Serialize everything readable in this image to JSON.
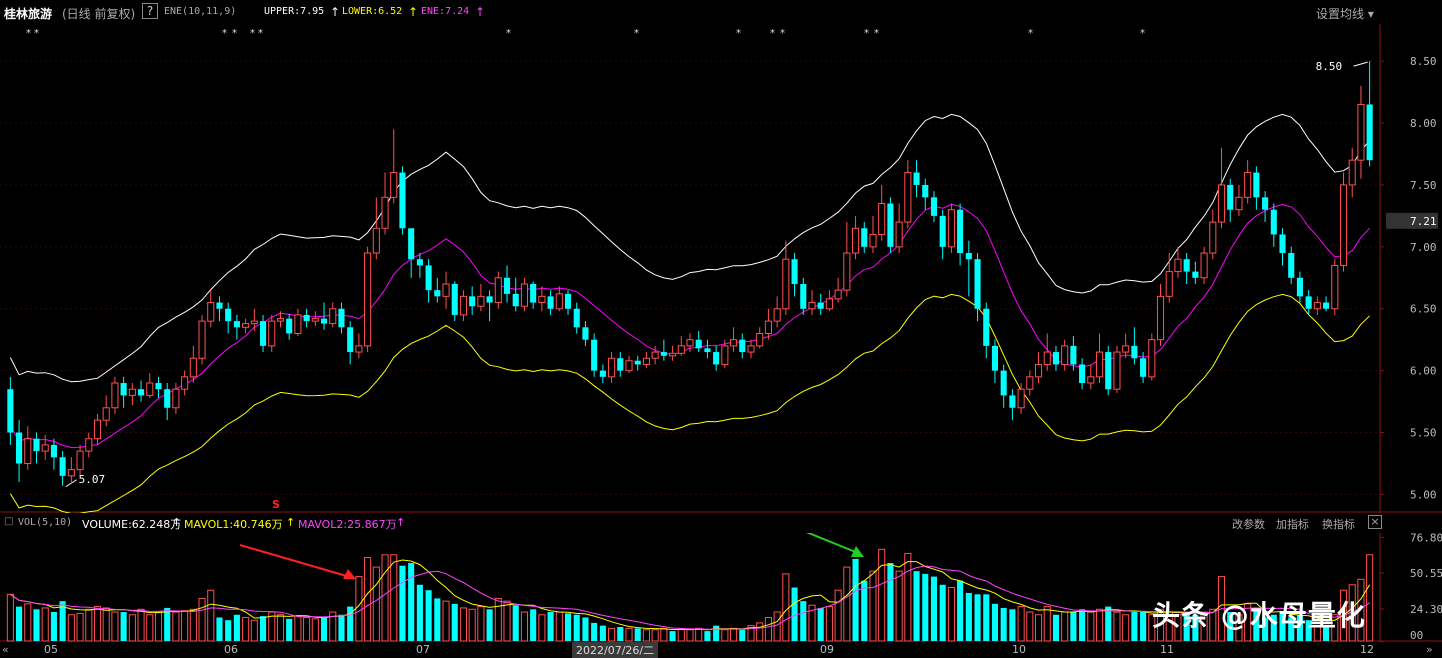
{
  "header": {
    "stock_name": "桂林旅游",
    "period_label": "(日线 前复权)",
    "help_icon": "?",
    "indicator_name": "ENE(10,11,9)",
    "upper_label": "UPPER:7.95",
    "lower_label": "LOWER:6.52",
    "ene_label": "ENE:7.24",
    "settings_label": "设置均线"
  },
  "vol_header": {
    "indicator_name": "VOL(5,10)",
    "volume_label": "VOLUME:62.248万",
    "mavol1_label": "MAVOL1:40.746万",
    "mavol2_label": "MAVOL2:25.867万",
    "btn_params": "改参数",
    "btn_add": "加指标",
    "btn_switch": "换指标",
    "close": "×"
  },
  "price_axis": {
    "ticks": [
      "8.50",
      "8.00",
      "7.50",
      "7.00",
      "6.50",
      "6.00",
      "5.50",
      "5.00"
    ],
    "current_price": "7.21"
  },
  "vol_axis": {
    "ticks": [
      "76.80",
      "50.55",
      "24.30",
      "00"
    ]
  },
  "x_axis": {
    "months": [
      "05",
      "06",
      "07",
      "09",
      "10",
      "11",
      "12"
    ],
    "cursor_date": "2022/07/26/二"
  },
  "annotations": {
    "high_label": "8.50",
    "low_label": "5.07",
    "signal_mark": "S"
  },
  "watermark": "头条 @水母量化",
  "colors": {
    "up": "#ff5050",
    "down": "#00ffff",
    "upper": "#ffffff",
    "ene": "#ff00ff",
    "lower": "#ffff00",
    "axis": "#8b1010"
  },
  "chart_data": {
    "type": "candlestick",
    "ylim": [
      4.85,
      8.8
    ],
    "vol_ylim": [
      0,
      80
    ],
    "candles": [
      [
        5.85,
        5.5,
        5.95,
        5.4
      ],
      [
        5.5,
        5.25,
        5.6,
        5.1
      ],
      [
        5.25,
        5.45,
        5.55,
        5.2
      ],
      [
        5.45,
        5.35,
        5.5,
        5.25
      ],
      [
        5.35,
        5.4,
        5.48,
        5.28
      ],
      [
        5.4,
        5.3,
        5.45,
        5.2
      ],
      [
        5.3,
        5.15,
        5.35,
        5.07
      ],
      [
        5.15,
        5.2,
        5.3,
        5.1
      ],
      [
        5.2,
        5.35,
        5.4,
        5.15
      ],
      [
        5.35,
        5.45,
        5.5,
        5.3
      ],
      [
        5.45,
        5.6,
        5.65,
        5.4
      ],
      [
        5.6,
        5.7,
        5.8,
        5.55
      ],
      [
        5.7,
        5.9,
        5.95,
        5.65
      ],
      [
        5.9,
        5.8,
        5.95,
        5.7
      ],
      [
        5.8,
        5.85,
        5.9,
        5.72
      ],
      [
        5.85,
        5.8,
        5.92,
        5.75
      ],
      [
        5.8,
        5.9,
        5.98,
        5.78
      ],
      [
        5.9,
        5.85,
        5.95,
        5.78
      ],
      [
        5.85,
        5.7,
        5.9,
        5.6
      ],
      [
        5.7,
        5.85,
        5.9,
        5.65
      ],
      [
        5.85,
        5.95,
        6.0,
        5.8
      ],
      [
        5.95,
        6.1,
        6.2,
        5.9
      ],
      [
        6.1,
        6.4,
        6.45,
        6.05
      ],
      [
        6.4,
        6.55,
        6.65,
        6.35
      ],
      [
        6.55,
        6.5,
        6.6,
        6.4
      ],
      [
        6.5,
        6.4,
        6.55,
        6.3
      ],
      [
        6.4,
        6.35,
        6.45,
        6.25
      ],
      [
        6.35,
        6.38,
        6.42,
        6.3
      ],
      [
        6.38,
        6.4,
        6.5,
        6.32
      ],
      [
        6.4,
        6.2,
        6.45,
        6.15
      ],
      [
        6.2,
        6.4,
        6.45,
        6.15
      ],
      [
        6.4,
        6.42,
        6.48,
        6.35
      ],
      [
        6.42,
        6.3,
        6.46,
        6.25
      ],
      [
        6.3,
        6.45,
        6.5,
        6.28
      ],
      [
        6.45,
        6.4,
        6.5,
        6.35
      ],
      [
        6.4,
        6.42,
        6.48,
        6.36
      ],
      [
        6.42,
        6.38,
        6.55,
        6.33
      ],
      [
        6.38,
        6.5,
        6.55,
        6.35
      ],
      [
        6.5,
        6.35,
        6.55,
        6.3
      ],
      [
        6.35,
        6.15,
        6.4,
        6.05
      ],
      [
        6.15,
        6.2,
        6.3,
        6.1
      ],
      [
        6.2,
        6.95,
        7.0,
        6.15
      ],
      [
        6.95,
        7.15,
        7.4,
        6.9
      ],
      [
        7.15,
        7.4,
        7.6,
        7.1
      ],
      [
        7.4,
        7.6,
        7.95,
        7.35
      ],
      [
        7.6,
        7.15,
        7.65,
        7.1
      ],
      [
        7.15,
        6.9,
        7.0,
        6.75
      ],
      [
        6.9,
        6.85,
        6.95,
        6.75
      ],
      [
        6.85,
        6.65,
        6.9,
        6.55
      ],
      [
        6.65,
        6.6,
        6.75,
        6.55
      ],
      [
        6.6,
        6.7,
        6.8,
        6.5
      ],
      [
        6.7,
        6.45,
        6.72,
        6.4
      ],
      [
        6.45,
        6.6,
        6.65,
        6.4
      ],
      [
        6.6,
        6.52,
        6.68,
        6.45
      ],
      [
        6.52,
        6.6,
        6.7,
        6.48
      ],
      [
        6.6,
        6.55,
        6.65,
        6.4
      ],
      [
        6.55,
        6.75,
        6.8,
        6.5
      ],
      [
        6.75,
        6.62,
        6.85,
        6.55
      ],
      [
        6.62,
        6.52,
        6.75,
        6.48
      ],
      [
        6.52,
        6.7,
        6.75,
        6.48
      ],
      [
        6.7,
        6.55,
        6.72,
        6.5
      ],
      [
        6.55,
        6.6,
        6.68,
        6.48
      ],
      [
        6.6,
        6.5,
        6.65,
        6.45
      ],
      [
        6.5,
        6.62,
        6.68,
        6.48
      ],
      [
        6.62,
        6.5,
        6.65,
        6.45
      ],
      [
        6.5,
        6.35,
        6.55,
        6.3
      ],
      [
        6.35,
        6.25,
        6.4,
        6.2
      ],
      [
        6.25,
        6.0,
        6.3,
        5.95
      ],
      [
        6.0,
        5.95,
        6.05,
        5.9
      ],
      [
        5.95,
        6.1,
        6.15,
        5.9
      ],
      [
        6.1,
        6.0,
        6.15,
        5.95
      ],
      [
        6.0,
        6.08,
        6.12,
        5.98
      ],
      [
        6.08,
        6.05,
        6.12,
        6.0
      ],
      [
        6.05,
        6.1,
        6.15,
        6.02
      ],
      [
        6.1,
        6.15,
        6.2,
        6.05
      ],
      [
        6.15,
        6.12,
        6.25,
        6.08
      ],
      [
        6.12,
        6.14,
        6.2,
        6.08
      ],
      [
        6.14,
        6.2,
        6.28,
        6.12
      ],
      [
        6.2,
        6.25,
        6.3,
        6.15
      ],
      [
        6.25,
        6.18,
        6.32,
        6.15
      ],
      [
        6.18,
        6.15,
        6.25,
        6.1
      ],
      [
        6.15,
        6.05,
        6.2,
        6.0
      ],
      [
        6.05,
        6.2,
        6.25,
        6.02
      ],
      [
        6.2,
        6.25,
        6.35,
        6.15
      ],
      [
        6.25,
        6.15,
        6.3,
        6.1
      ],
      [
        6.15,
        6.2,
        6.25,
        6.1
      ],
      [
        6.2,
        6.3,
        6.35,
        6.18
      ],
      [
        6.3,
        6.4,
        6.5,
        6.25
      ],
      [
        6.4,
        6.5,
        6.6,
        6.35
      ],
      [
        6.5,
        6.9,
        7.05,
        6.45
      ],
      [
        6.9,
        6.7,
        6.95,
        6.6
      ],
      [
        6.7,
        6.5,
        6.75,
        6.45
      ],
      [
        6.5,
        6.55,
        6.65,
        6.45
      ],
      [
        6.55,
        6.5,
        6.62,
        6.45
      ],
      [
        6.5,
        6.58,
        6.65,
        6.48
      ],
      [
        6.58,
        6.65,
        6.75,
        6.55
      ],
      [
        6.65,
        6.95,
        7.2,
        6.6
      ],
      [
        6.95,
        7.15,
        7.25,
        6.9
      ],
      [
        7.15,
        7.0,
        7.2,
        6.95
      ],
      [
        7.0,
        7.1,
        7.25,
        6.95
      ],
      [
        7.1,
        7.35,
        7.5,
        7.05
      ],
      [
        7.35,
        7.0,
        7.4,
        6.95
      ],
      [
        7.0,
        7.2,
        7.35,
        6.95
      ],
      [
        7.2,
        7.6,
        7.7,
        7.15
      ],
      [
        7.6,
        7.5,
        7.7,
        7.4
      ],
      [
        7.5,
        7.4,
        7.55,
        7.3
      ],
      [
        7.4,
        7.25,
        7.45,
        7.2
      ],
      [
        7.25,
        7.0,
        7.3,
        6.9
      ],
      [
        7.0,
        7.3,
        7.35,
        6.95
      ],
      [
        7.3,
        6.95,
        7.35,
        6.85
      ],
      [
        6.95,
        6.9,
        7.05,
        6.6
      ],
      [
        6.9,
        6.5,
        6.95,
        6.4
      ],
      [
        6.5,
        6.2,
        6.55,
        6.1
      ],
      [
        6.2,
        6.0,
        6.25,
        5.9
      ],
      [
        6.0,
        5.8,
        6.05,
        5.7
      ],
      [
        5.8,
        5.7,
        5.85,
        5.6
      ],
      [
        5.7,
        5.85,
        5.9,
        5.65
      ],
      [
        5.85,
        5.95,
        6.0,
        5.8
      ],
      [
        5.95,
        6.05,
        6.15,
        5.9
      ],
      [
        6.05,
        6.15,
        6.3,
        6.0
      ],
      [
        6.15,
        6.05,
        6.2,
        6.0
      ],
      [
        6.05,
        6.2,
        6.25,
        6.0
      ],
      [
        6.2,
        6.05,
        6.28,
        6.0
      ],
      [
        6.05,
        5.9,
        6.1,
        5.85
      ],
      [
        5.9,
        5.95,
        6.05,
        5.85
      ],
      [
        5.95,
        6.15,
        6.3,
        5.9
      ],
      [
        6.15,
        5.85,
        6.2,
        5.8
      ],
      [
        5.85,
        6.15,
        6.2,
        5.82
      ],
      [
        6.15,
        6.2,
        6.3,
        6.1
      ],
      [
        6.2,
        6.1,
        6.35,
        6.05
      ],
      [
        6.1,
        5.95,
        6.15,
        5.9
      ],
      [
        5.95,
        6.25,
        6.3,
        5.92
      ],
      [
        6.25,
        6.6,
        6.7,
        6.2
      ],
      [
        6.6,
        6.8,
        6.95,
        6.55
      ],
      [
        6.8,
        6.9,
        7.0,
        6.75
      ],
      [
        6.9,
        6.8,
        6.95,
        6.7
      ],
      [
        6.8,
        6.75,
        6.88,
        6.7
      ],
      [
        6.75,
        6.95,
        7.0,
        6.7
      ],
      [
        6.95,
        7.2,
        7.3,
        6.9
      ],
      [
        7.2,
        7.5,
        7.8,
        7.15
      ],
      [
        7.5,
        7.3,
        7.55,
        7.2
      ],
      [
        7.3,
        7.4,
        7.5,
        7.25
      ],
      [
        7.4,
        7.6,
        7.7,
        7.35
      ],
      [
        7.6,
        7.4,
        7.65,
        7.3
      ],
      [
        7.4,
        7.3,
        7.45,
        7.2
      ],
      [
        7.3,
        7.1,
        7.35,
        7.0
      ],
      [
        7.1,
        6.95,
        7.15,
        6.85
      ],
      [
        6.95,
        6.75,
        7.0,
        6.7
      ],
      [
        6.75,
        6.6,
        6.8,
        6.55
      ],
      [
        6.6,
        6.5,
        6.65,
        6.45
      ],
      [
        6.5,
        6.55,
        6.6,
        6.45
      ],
      [
        6.55,
        6.5,
        6.6,
        6.48
      ],
      [
        6.5,
        6.85,
        6.9,
        6.45
      ],
      [
        6.85,
        7.5,
        7.6,
        6.8
      ],
      [
        7.5,
        7.7,
        7.8,
        7.4
      ],
      [
        7.7,
        8.15,
        8.3,
        7.55
      ],
      [
        8.15,
        7.7,
        8.5,
        7.65
      ]
    ],
    "volumes": [
      [
        35,
        1
      ],
      [
        26,
        0
      ],
      [
        28,
        1
      ],
      [
        24,
        0
      ],
      [
        25,
        1
      ],
      [
        22,
        0
      ],
      [
        30,
        0
      ],
      [
        20,
        1
      ],
      [
        21,
        1
      ],
      [
        24,
        1
      ],
      [
        26,
        1
      ],
      [
        25,
        1
      ],
      [
        22,
        1
      ],
      [
        22,
        0
      ],
      [
        20,
        1
      ],
      [
        24,
        1
      ],
      [
        20,
        1
      ],
      [
        22,
        1
      ],
      [
        25,
        0
      ],
      [
        22,
        1
      ],
      [
        23,
        1
      ],
      [
        24,
        1
      ],
      [
        32,
        1
      ],
      [
        38,
        1
      ],
      [
        18,
        0
      ],
      [
        16,
        0
      ],
      [
        20,
        0
      ],
      [
        18,
        1
      ],
      [
        16,
        1
      ],
      [
        19,
        0
      ],
      [
        22,
        1
      ],
      [
        20,
        1
      ],
      [
        17,
        0
      ],
      [
        19,
        1
      ],
      [
        18,
        1
      ],
      [
        17,
        1
      ],
      [
        18,
        0
      ],
      [
        22,
        1
      ],
      [
        20,
        0
      ],
      [
        26,
        0
      ],
      [
        48,
        1
      ],
      [
        62,
        1
      ],
      [
        55,
        1
      ],
      [
        64,
        1
      ],
      [
        64,
        1
      ],
      [
        56,
        0
      ],
      [
        58,
        0
      ],
      [
        42,
        0
      ],
      [
        38,
        0
      ],
      [
        32,
        0
      ],
      [
        30,
        1
      ],
      [
        28,
        0
      ],
      [
        25,
        1
      ],
      [
        24,
        1
      ],
      [
        26,
        1
      ],
      [
        24,
        0
      ],
      [
        32,
        1
      ],
      [
        30,
        1
      ],
      [
        27,
        0
      ],
      [
        22,
        1
      ],
      [
        24,
        0
      ],
      [
        20,
        1
      ],
      [
        22,
        0
      ],
      [
        22,
        1
      ],
      [
        21,
        0
      ],
      [
        20,
        0
      ],
      [
        18,
        0
      ],
      [
        14,
        0
      ],
      [
        12,
        0
      ],
      [
        10,
        1
      ],
      [
        11,
        0
      ],
      [
        10,
        1
      ],
      [
        10,
        0
      ],
      [
        9,
        1
      ],
      [
        9,
        1
      ],
      [
        10,
        1
      ],
      [
        8,
        0
      ],
      [
        10,
        1
      ],
      [
        9,
        1
      ],
      [
        10,
        1
      ],
      [
        8,
        0
      ],
      [
        12,
        0
      ],
      [
        9,
        1
      ],
      [
        10,
        1
      ],
      [
        9,
        0
      ],
      [
        12,
        1
      ],
      [
        14,
        1
      ],
      [
        18,
        1
      ],
      [
        22,
        1
      ],
      [
        50,
        1
      ],
      [
        40,
        0
      ],
      [
        30,
        0
      ],
      [
        27,
        1
      ],
      [
        25,
        0
      ],
      [
        26,
        1
      ],
      [
        38,
        1
      ],
      [
        55,
        1
      ],
      [
        61,
        0
      ],
      [
        45,
        0
      ],
      [
        52,
        1
      ],
      [
        68,
        1
      ],
      [
        58,
        0
      ],
      [
        52,
        1
      ],
      [
        65,
        1
      ],
      [
        52,
        0
      ],
      [
        50,
        0
      ],
      [
        48,
        0
      ],
      [
        42,
        0
      ],
      [
        40,
        1
      ],
      [
        45,
        0
      ],
      [
        36,
        0
      ],
      [
        35,
        0
      ],
      [
        35,
        0
      ],
      [
        28,
        0
      ],
      [
        25,
        0
      ],
      [
        24,
        0
      ],
      [
        26,
        1
      ],
      [
        22,
        1
      ],
      [
        20,
        1
      ],
      [
        26,
        1
      ],
      [
        20,
        0
      ],
      [
        22,
        1
      ],
      [
        22,
        0
      ],
      [
        24,
        0
      ],
      [
        22,
        1
      ],
      [
        24,
        1
      ],
      [
        26,
        0
      ],
      [
        22,
        1
      ],
      [
        20,
        1
      ],
      [
        22,
        0
      ],
      [
        22,
        0
      ],
      [
        20,
        1
      ],
      [
        24,
        1
      ],
      [
        22,
        1
      ],
      [
        20,
        1
      ],
      [
        22,
        0
      ],
      [
        20,
        0
      ],
      [
        22,
        1
      ],
      [
        24,
        1
      ],
      [
        48,
        1
      ],
      [
        22,
        0
      ],
      [
        20,
        1
      ],
      [
        28,
        1
      ],
      [
        24,
        0
      ],
      [
        18,
        0
      ],
      [
        20,
        0
      ],
      [
        22,
        0
      ],
      [
        18,
        0
      ],
      [
        20,
        0
      ],
      [
        16,
        0
      ],
      [
        12,
        1
      ],
      [
        12,
        0
      ],
      [
        20,
        1
      ],
      [
        38,
        1
      ],
      [
        42,
        1
      ],
      [
        46,
        1
      ],
      [
        64,
        1
      ]
    ],
    "series": [
      {
        "name": "UPPER",
        "values": [
          7.95
        ]
      },
      {
        "name": "LOWER",
        "values": [
          6.52
        ]
      },
      {
        "name": "ENE",
        "values": [
          7.24
        ]
      }
    ]
  }
}
